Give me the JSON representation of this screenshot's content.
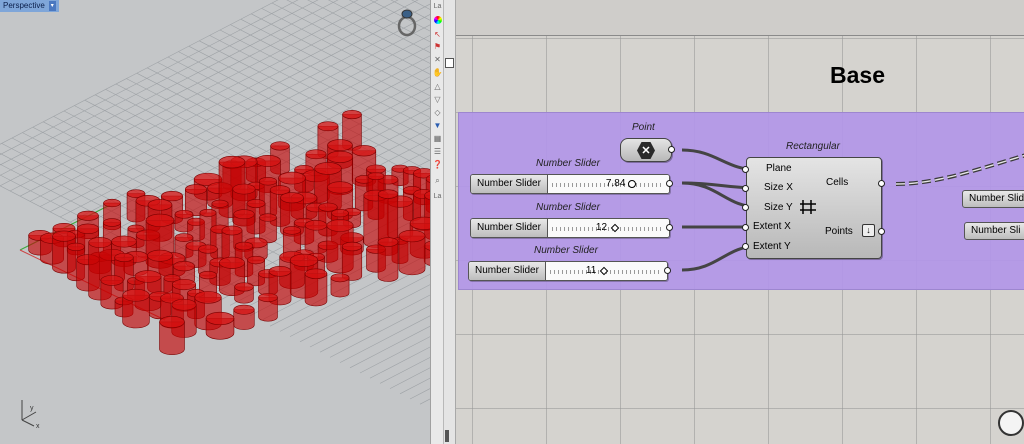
{
  "viewport": {
    "tab_label": "Perspective",
    "tab_arrow": "▾",
    "axis_y": "y",
    "axis_x": "x"
  },
  "divider": {
    "top_label": "La",
    "side_label": "La"
  },
  "canvas": {
    "group_title": "Base",
    "point": {
      "title": "Point"
    },
    "rect": {
      "title": "Rectangular",
      "inputs": [
        "Plane",
        "Size X",
        "Size Y",
        "Extent X",
        "Extent Y"
      ],
      "outputs": [
        "Cells",
        "Points"
      ]
    },
    "sliders": [
      {
        "title": "Number Slider",
        "label": "Number Slider",
        "value": "7.84"
      },
      {
        "title": "Number Slider",
        "label": "Number Slider",
        "value": "12"
      },
      {
        "title": "Number Slider",
        "label": "Number Slider",
        "value": "11"
      }
    ],
    "right_nodes": [
      "Number Slid",
      "Number Sli"
    ]
  },
  "colors": {
    "group_fill": "#b296e8",
    "cylinder_red": "#c40000",
    "grid_bg": "#c4c6c8"
  }
}
